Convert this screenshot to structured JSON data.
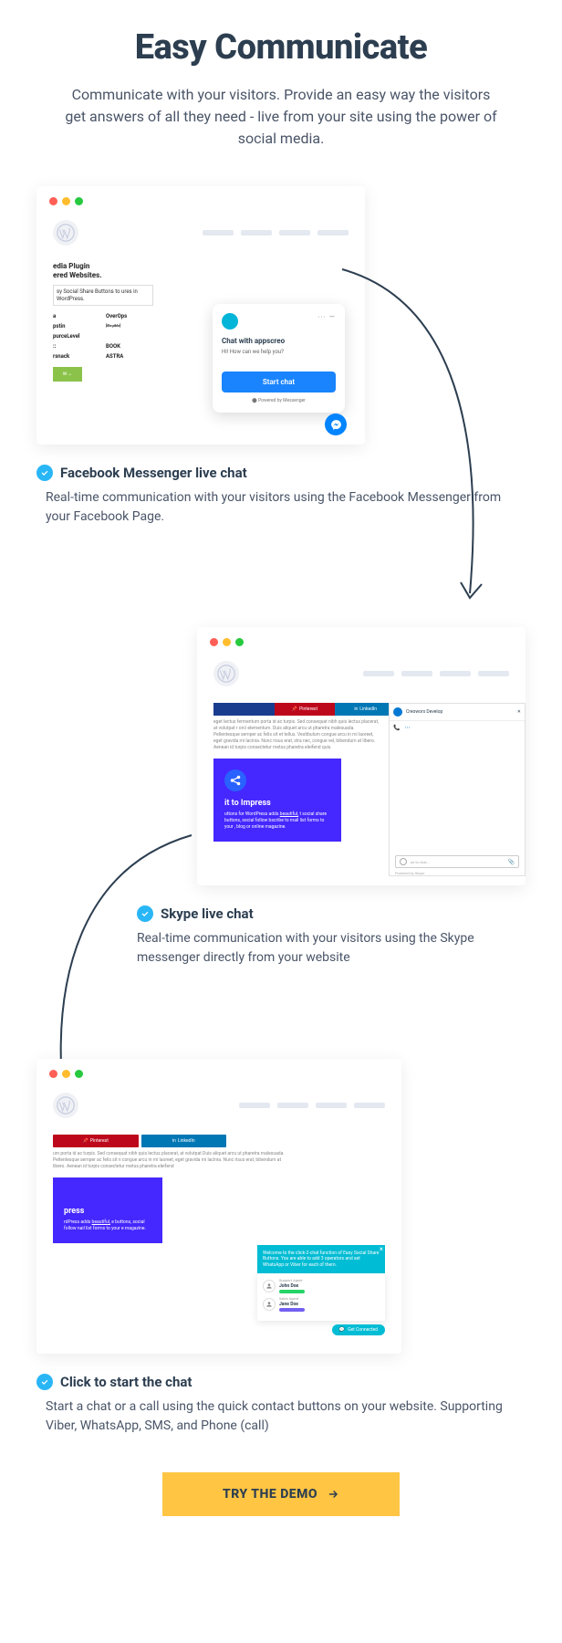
{
  "header": {
    "title": "Easy Communicate",
    "subtitle": "Communicate with your visitors. Provide an easy way the visitors get answers of all they need - live from your site using the power of social media."
  },
  "card1": {
    "hero_title": "edia Plugin\nered Websites.",
    "hero_sub": "sy Social Share Buttons to ures in WordPress.",
    "logos": [
      "a",
      "OverOps",
      "pstin",
      "[illegible]",
      "purceLevel",
      "",
      "::",
      "BOOK",
      "rsnack",
      "ASTRA"
    ],
    "btn": "w",
    "chat": {
      "title": "Chat with appscreo",
      "question": "Hi! How can we help you?",
      "button": "Start chat",
      "powered": "Powered by Messenger",
      "dots": "··· —"
    }
  },
  "feature1": {
    "title": "Facebook Messenger live chat",
    "desc": "Real-time communication with your visitors using the Facebook Messenger from your Facebook Page."
  },
  "card2": {
    "tabs": {
      "pin": "Pinterest",
      "li": "LinkedIn"
    },
    "lorem": "eget lectus fermentum porta id ac turpis. Sed consequat nibh quis lectus placerat, at volutpat r orci elementum. Duis aliquet arcu ut pharetra malesuada. Pellentesque semper ac felis sit et tellus. Vestibulum congue arcu in mi laoreet, eget gravida mi lacinia. Nunc risus erat, stra nec, congue vel, bibendum at libero. Aenean id turpis consectetur metus pharetra eleifend quis.",
    "purple": {
      "title": "it to Impress",
      "desc": "uttons for WordPress adds ",
      "desc_u": "beautiful,",
      "desc2": " t social share buttons, social follow bscribe to mail list forms to your , blog or online magazine."
    },
    "skype": {
      "name": "Creoworx Develop",
      "placeholder": "pe to chat...",
      "powered": "Powered by Skype"
    }
  },
  "feature2": {
    "title": "Skype live chat",
    "desc": "Real-time communication with your visitors using the Skype messenger directly from your website"
  },
  "card3": {
    "tabs": {
      "pin": "Pinterest",
      "li": "LinkedIn"
    },
    "lorem": "um porta id ac turpis. Sed consequat nibh quis lectus placerat, at volutpat Duis aliquet arcu ut pharetra malesuada. Pellentesque semper ac felis sit n congue arcu in mi laoreet, eget gravida mi lacinia. Nunc risus erat, bibendum at libero. Aenean id turpis consectetur metus pharetra eleifend",
    "purple": {
      "title": "press",
      "desc": "rdPress adds ",
      "desc_u": "beautiful,",
      "desc2": " e buttons, social follow nail list forms to your e magazine."
    },
    "contact": {
      "banner": "Welcome to the click-2-chat function of Easy Social Share Buttons. You are able to add 3 operators and set WhatsApp or Viber for each of them.",
      "agent1": {
        "role": "Support Agent",
        "name": "John Doe"
      },
      "agent2": {
        "role": "Sales Agent",
        "name": "Jane Doe"
      },
      "connect": "Get Connected"
    }
  },
  "feature3": {
    "title": "Click to start the chat",
    "desc": "Start a chat or a call using the quick contact buttons on your website. Supporting Viber, WhatsApp, SMS, and Phone (call)"
  },
  "cta": "TRY THE DEMO"
}
